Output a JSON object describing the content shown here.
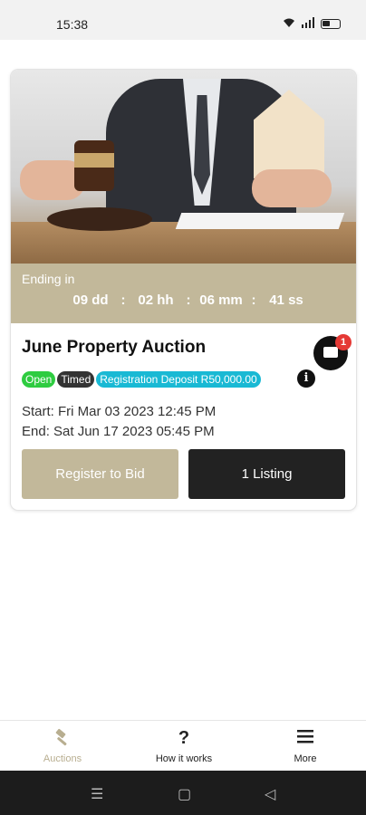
{
  "status_bar": {
    "time": "15:38"
  },
  "auction": {
    "timer_label": "Ending in",
    "timer": {
      "days": "09 dd",
      "hours": "02 hh",
      "minutes": "06 mm",
      "seconds": "41 ss",
      "separator": ":"
    },
    "title": "June Property Auction",
    "chat_badge": "1",
    "tags": {
      "open": "Open",
      "timed": "Timed",
      "deposit": "Registration Deposit R50,000.00"
    },
    "info_glyph": "i",
    "start": "Start: Fri Mar 03 2023 12:45 PM",
    "end": "End: Sat Jun 17 2023 05:45 PM",
    "register_label": "Register to Bid",
    "listing_label": "1 Listing"
  },
  "bottom_nav": {
    "auctions": "Auctions",
    "how_it_works": "How it works",
    "more": "More"
  },
  "colors": {
    "accent": "#c2b89a",
    "dark_button": "#222222",
    "open_tag": "#2ecc40",
    "deposit_tag": "#19b9d4",
    "badge": "#e53935"
  },
  "icons": [
    "gavel-icon",
    "question-icon",
    "menu-icon",
    "chat-icon",
    "info-icon"
  ]
}
